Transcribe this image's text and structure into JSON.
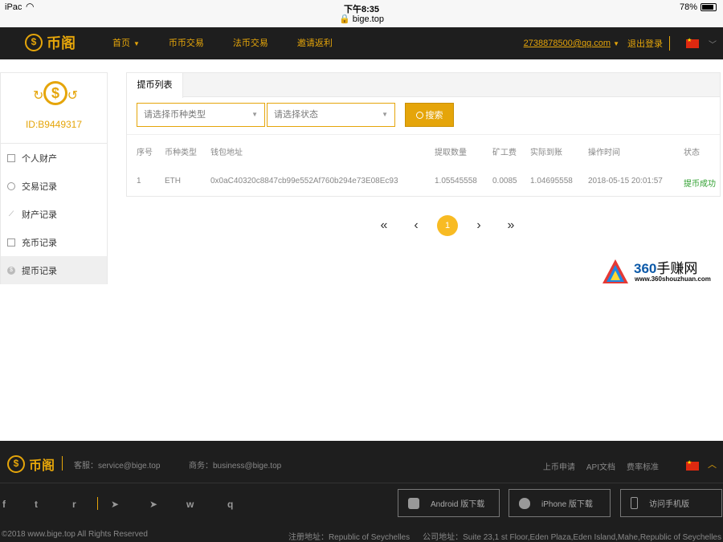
{
  "statusbar": {
    "device": "iPac",
    "time": "下午8:35",
    "url": "🔒 bige.top",
    "battery": "78%"
  },
  "brand": {
    "name": "币阁"
  },
  "nav": {
    "items": [
      {
        "label": "首页",
        "dropdown": true
      },
      {
        "label": "币币交易"
      },
      {
        "label": "法币交易"
      },
      {
        "label": "邀请返利"
      }
    ],
    "email": "2738878500@qq.com",
    "logout": "退出登录"
  },
  "sidebar": {
    "uid": "ID:B9449317",
    "items": [
      {
        "label": "个人财产",
        "icon": "wallet-icon"
      },
      {
        "label": "交易记录",
        "icon": "trade-icon"
      },
      {
        "label": "财产记录",
        "icon": "chart-icon"
      },
      {
        "label": "充币记录",
        "icon": "deposit-icon"
      },
      {
        "label": "提币记录",
        "icon": "withdraw-icon",
        "active": true
      }
    ]
  },
  "panel": {
    "tab": "提币列表",
    "filters": {
      "coin_placeholder": "请选择币种类型",
      "status_placeholder": "请选择状态"
    },
    "search_label": "搜索",
    "columns": [
      "序号",
      "币种类型",
      "钱包地址",
      "提取数量",
      "矿工费",
      "实际到账",
      "操作时间",
      "状态"
    ],
    "rows": [
      [
        "1",
        "ETH",
        "0x0aC40320c8847cb99e552Af760b294e73E08Ec93",
        "1.05545558",
        "0.0085",
        "1.04695558",
        "2018-05-15 20:01:57",
        "提币成功"
      ]
    ]
  },
  "pagination": {
    "current": "1",
    "first": "«",
    "prev": "‹",
    "next": "›",
    "last": "»"
  },
  "watermark": {
    "title_num": "360",
    "title_text": "手赚网",
    "site": "www.360shouzhuan.com"
  },
  "footer": {
    "support": "客服：service@bige.top",
    "business": "商务：business@bige.top",
    "links": [
      "上币申请",
      "API文档",
      "费率标准"
    ],
    "downloads": [
      "Android 版下载",
      "iPhone 版下载",
      "访问手机版"
    ],
    "social": [
      "f",
      "t",
      "r",
      "➤",
      "➤",
      "w",
      "q"
    ],
    "copyright": "©2018 www.bige.top All Rights Reserved",
    "reg_address": "注册地址：Republic of Seychelles",
    "office_address": "公司地址：Suite 23,1 st Floor,Eden Plaza,Eden Island,Mahe,Republic of Seychelles"
  },
  "colors": {
    "accent": "#e5a50a",
    "dark": "#1e1e1e",
    "success": "#2e9f2e",
    "page_active": "#f8bb23"
  }
}
